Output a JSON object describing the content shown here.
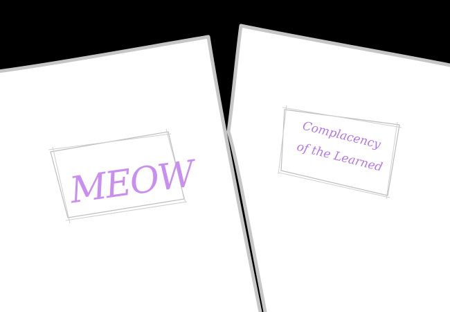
{
  "scene": {
    "background_color": "#000000",
    "sheet_color": "#ffffff",
    "sheet_edge_color": "#c6c6c6",
    "ink_color": "#c98ff0"
  },
  "left_sheet": {
    "label": "MEOW"
  },
  "right_sheet": {
    "label_line_1": "Complacency",
    "label_line_2": "of the Learned"
  }
}
